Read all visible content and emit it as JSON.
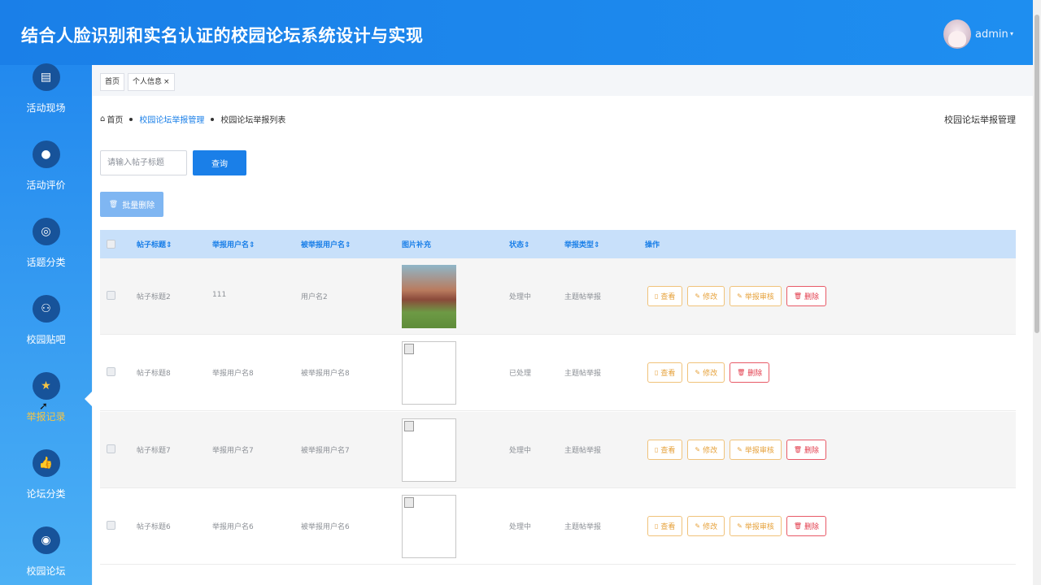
{
  "header": {
    "title": "结合人脸识别和实名认证的校园论坛系统设计与实现",
    "user": "admin",
    "caret": "▾"
  },
  "sidebar": {
    "items": [
      {
        "label": "活动现场",
        "icon": "document-icon",
        "glyph": "▤"
      },
      {
        "label": "活动评价",
        "icon": "chat-icon",
        "glyph": "●"
      },
      {
        "label": "话题分类",
        "icon": "target-icon",
        "glyph": "◎"
      },
      {
        "label": "校园贴吧",
        "icon": "user-icon",
        "glyph": "⚇"
      },
      {
        "label": "举报记录",
        "icon": "star-icon",
        "glyph": "★"
      },
      {
        "label": "论坛分类",
        "icon": "thumb-up-icon",
        "glyph": "👍"
      },
      {
        "label": "校园论坛",
        "icon": "eye-icon",
        "glyph": "◉"
      }
    ],
    "active_index": 4
  },
  "tabs": [
    {
      "label": "首页"
    },
    {
      "label": "个人信息",
      "close": "×"
    }
  ],
  "breadcrumb": {
    "home": "首页",
    "level1": "校园论坛举报管理",
    "level2": "校园论坛举报列表",
    "home_icon": "⌂"
  },
  "page_title": "校园论坛举报管理",
  "search": {
    "placeholder": "请输入帖子标题",
    "button": "查询"
  },
  "batch_delete": {
    "label": "批量删除",
    "icon": "🗑"
  },
  "table": {
    "columns": [
      "帖子标题",
      "举报用户名",
      "被举报用户名",
      "图片补充",
      "状态",
      "举报类型",
      "操作"
    ],
    "sort_glyph": "⇕",
    "rows": [
      {
        "title": "帖子标题2",
        "reporter": "111",
        "reported": "用户名2",
        "image": "photo",
        "status": "处理中",
        "type": "主题帖举报",
        "actions": [
          "查看",
          "修改",
          "举报审核",
          "删除"
        ]
      },
      {
        "title": "帖子标题8",
        "reporter": "举报用户名8",
        "reported": "被举报用户名8",
        "image": "broken",
        "status": "已处理",
        "type": "主题帖举报",
        "actions": [
          "查看",
          "修改",
          "删除"
        ]
      },
      {
        "title": "帖子标题7",
        "reporter": "举报用户名7",
        "reported": "被举报用户名7",
        "image": "broken",
        "status": "处理中",
        "type": "主题帖举报",
        "actions": [
          "查看",
          "修改",
          "举报审核",
          "删除"
        ]
      },
      {
        "title": "帖子标题6",
        "reporter": "举报用户名6",
        "reported": "被举报用户名6",
        "image": "broken",
        "status": "处理中",
        "type": "主题帖举报",
        "actions": [
          "查看",
          "修改",
          "举报审核",
          "删除"
        ]
      }
    ]
  },
  "colors": {
    "header": "#1a7fe8",
    "sidebar_active": "#f5c544",
    "warn": "#e6a23c",
    "danger": "#e23b4b"
  }
}
